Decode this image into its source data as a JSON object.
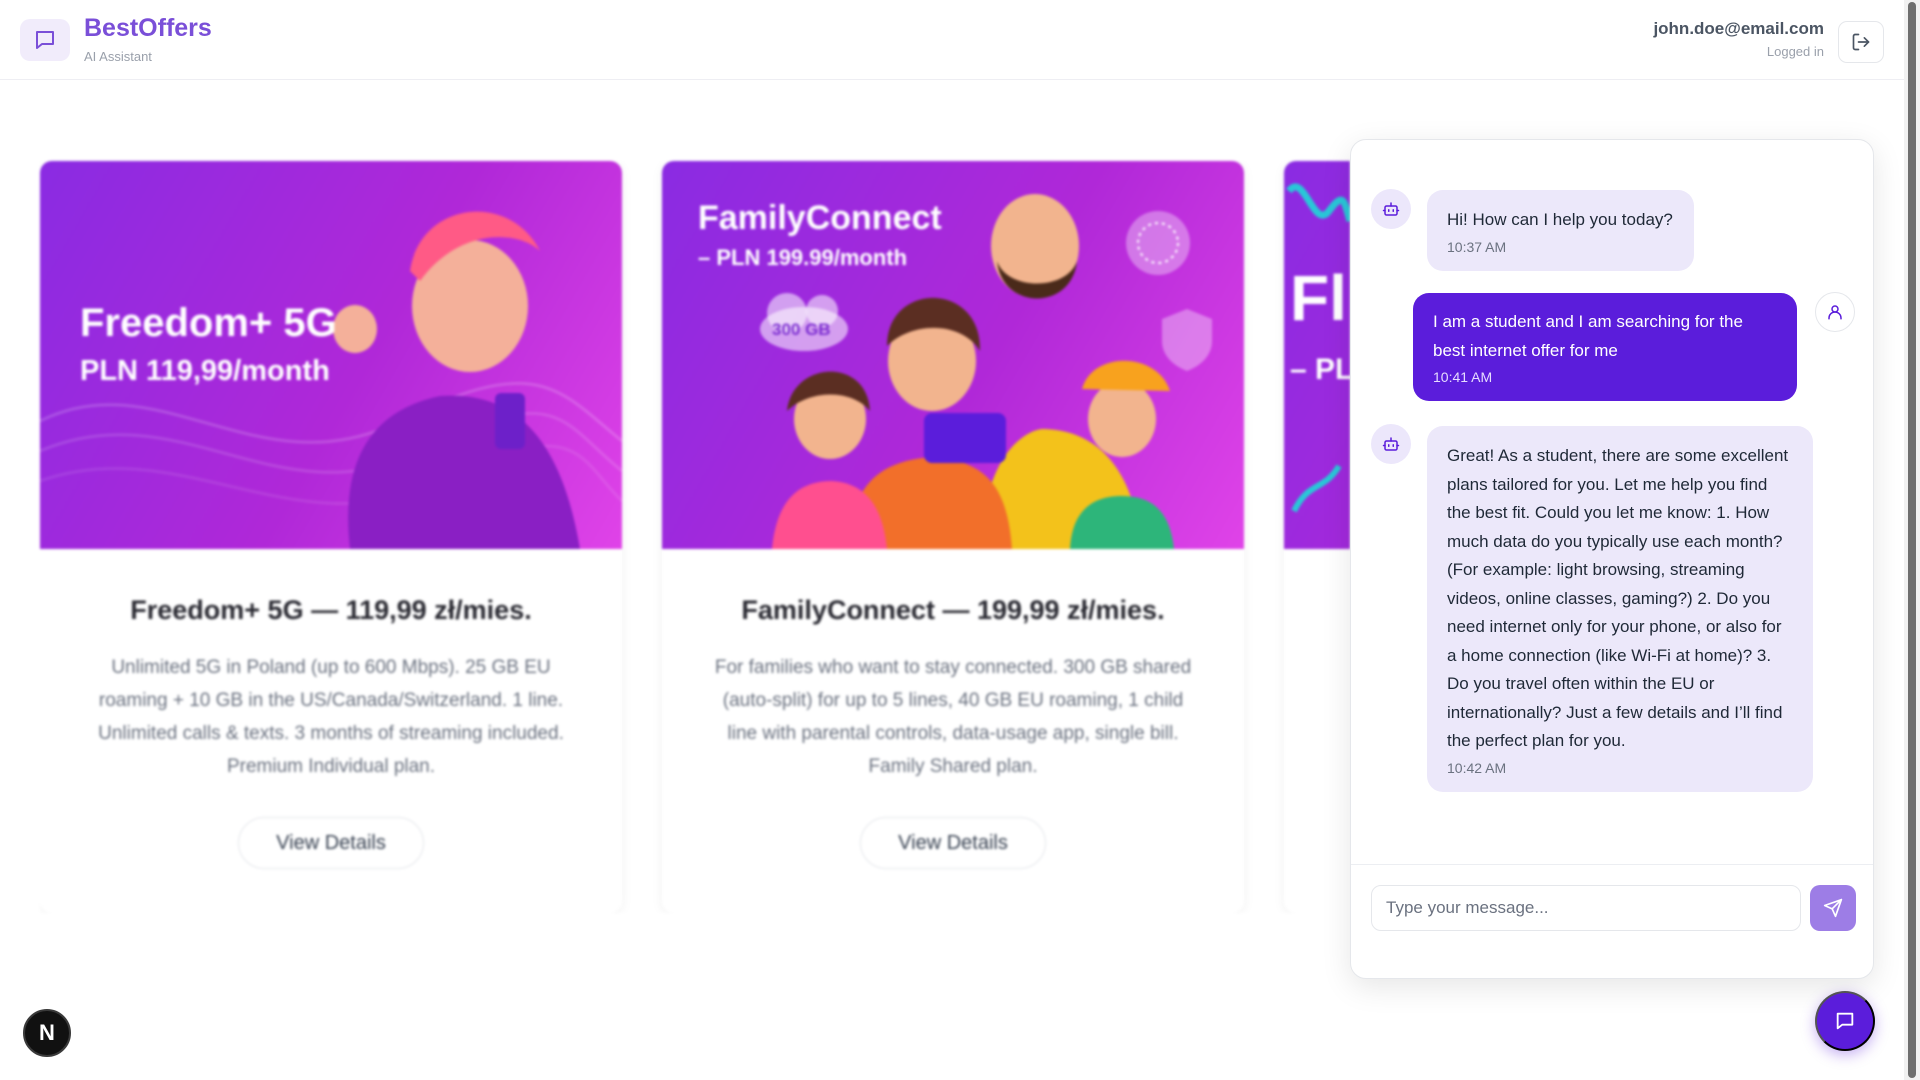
{
  "header": {
    "brand_name": "BestOffers",
    "brand_sub": "AI Assistant",
    "user_email": "john.doe@email.com",
    "user_status": "Logged in"
  },
  "cards": [
    {
      "img_title": "Freedom+ 5G",
      "img_price": "PLN 119,99/month",
      "title": "Freedom+ 5G — 119,99 zł/mies.",
      "description": "Unlimited 5G in Poland (up to 600 Mbps). 25 GB EU roaming + 10 GB in the US/Canada/Switzerland. 1 line. Unlimited calls & texts. 3 months of streaming included. Premium Individual plan.",
      "button": "View Details"
    },
    {
      "img_title": "FamilyConnect",
      "img_price": "– PLN 199.99/month",
      "img_badge": "300 GB",
      "title": "FamilyConnect — 199,99 zł/mies.",
      "description": "For families who want to stay connected. 300 GB shared (auto-split) for up to 5 lines, 40 GB EU roaming, 1 child line with parental controls, data-usage app, single bill. Family Shared plan.",
      "button": "View Details"
    },
    {
      "img_title": "Fl",
      "img_price": "– PL"
    }
  ],
  "chat": {
    "messages": [
      {
        "sender": "bot",
        "text": "Hi! How can I help you today?",
        "time": "10:37 AM"
      },
      {
        "sender": "user",
        "text": "I am a student and I am searching for the best internet offer for me",
        "time": "10:41 AM"
      },
      {
        "sender": "bot",
        "text": "Great! As a student, there are some excellent plans tailored for you. Let me help you find the best fit. Could you let me know: 1. How much data do you typically use each month? (For example: light browsing, streaming videos, online classes, gaming?) 2. Do you need internet only for your phone, or also for a home connection (like Wi-Fi at home)? 3. Do you travel often within the EU or internationally? Just a few details and I’ll find the perfect plan for you.",
        "time": "10:42 AM"
      }
    ],
    "input_placeholder": "Type your message...",
    "input_value": ""
  },
  "next_badge": "N",
  "colors": {
    "accent": "#5b1ddb",
    "brand": "#7a4fd8",
    "bot_bubble": "#ece8fa",
    "card_gradient_start": "#8a2be2",
    "card_gradient_end": "#e043e8"
  },
  "icons": {
    "brand": "chat-bubble-icon",
    "logout": "logout-icon",
    "bot": "robot-icon",
    "user": "user-icon",
    "send": "send-icon",
    "fab": "chat-bubble-icon"
  }
}
